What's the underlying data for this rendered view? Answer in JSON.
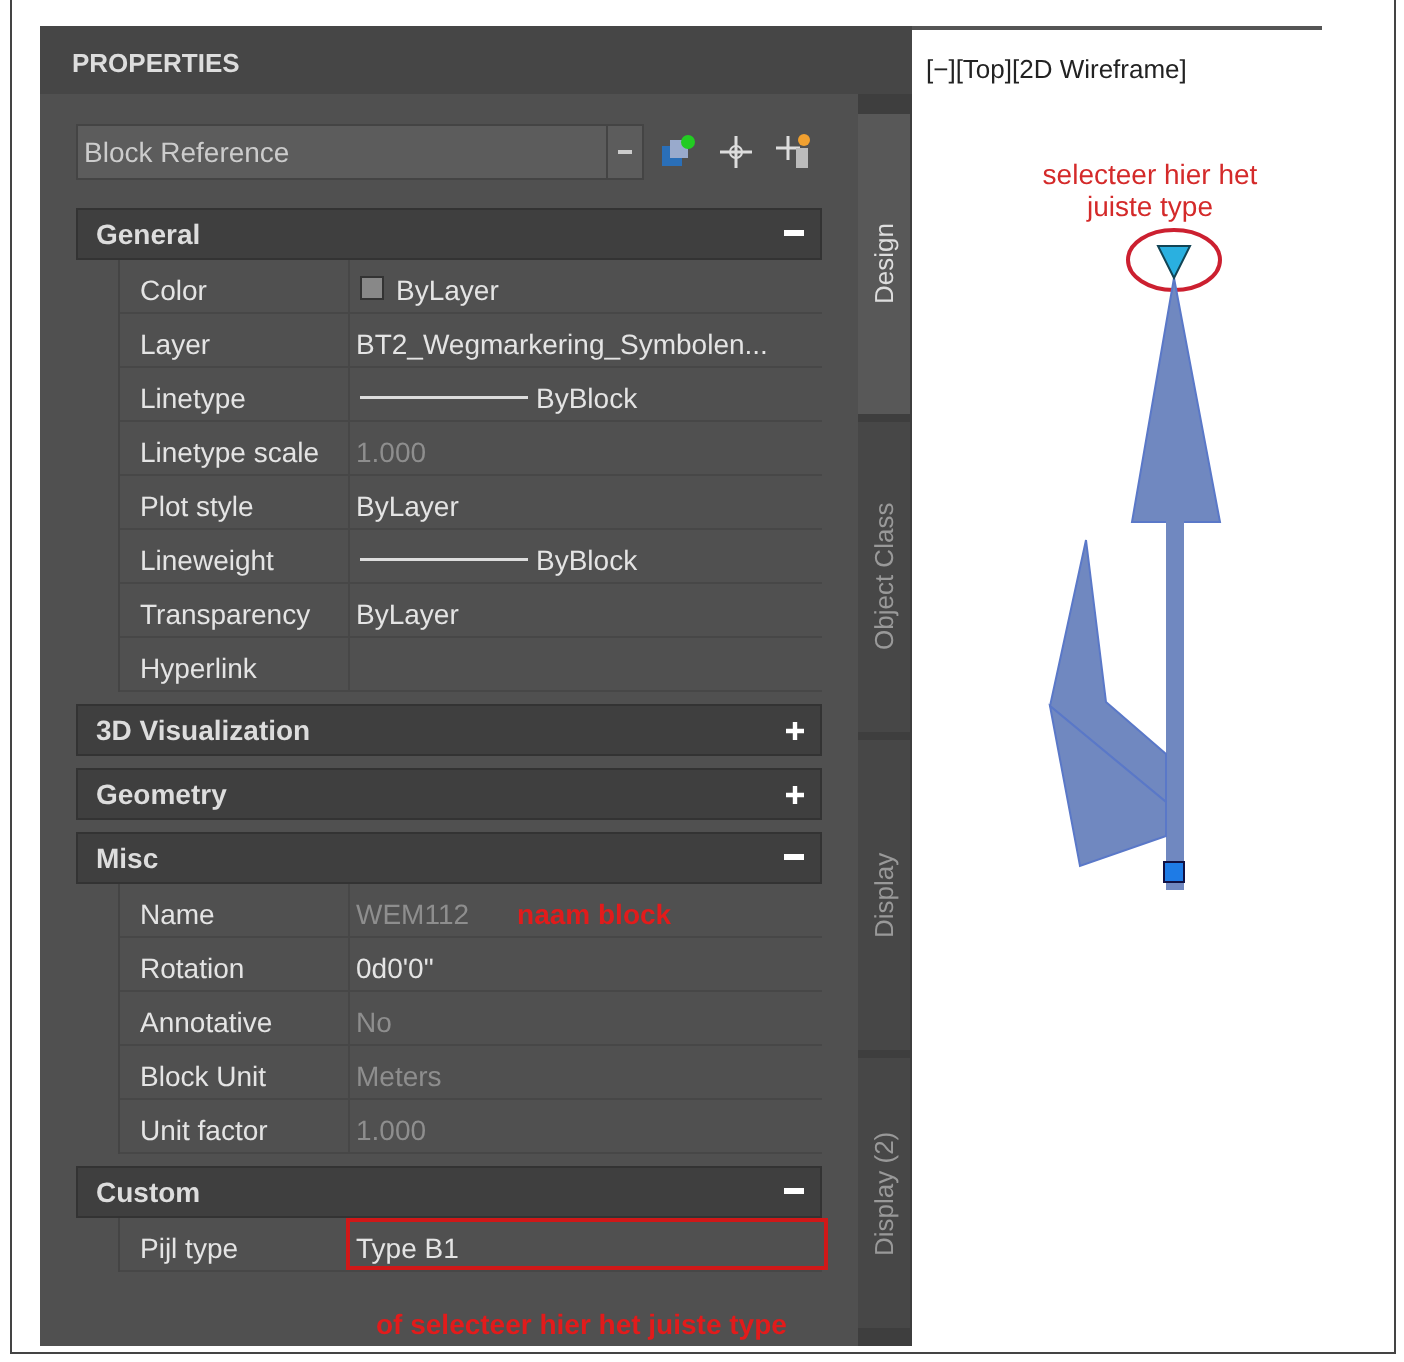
{
  "panel": {
    "title": "PROPERTIES",
    "selector": {
      "value": "Block Reference"
    },
    "sections": [
      {
        "title": "General",
        "expanded": true,
        "rows": [
          {
            "label": "Color",
            "value": "ByLayer",
            "kind": "color",
            "disabled": false
          },
          {
            "label": "Layer",
            "value": "BT2_Wegmarkering_Symbolen...",
            "kind": "text",
            "disabled": false
          },
          {
            "label": "Linetype",
            "value": "ByBlock",
            "kind": "line",
            "disabled": false
          },
          {
            "label": "Linetype scale",
            "value": "1.000",
            "kind": "text",
            "disabled": true
          },
          {
            "label": "Plot style",
            "value": "ByLayer",
            "kind": "text",
            "disabled": false
          },
          {
            "label": "Lineweight",
            "value": "ByBlock",
            "kind": "line",
            "disabled": false
          },
          {
            "label": "Transparency",
            "value": "ByLayer",
            "kind": "text",
            "disabled": false
          },
          {
            "label": "Hyperlink",
            "kind": "text",
            "disabled": false
          }
        ]
      },
      {
        "title": "3D Visualization",
        "expanded": false
      },
      {
        "title": "Geometry",
        "expanded": false
      },
      {
        "title": "Misc",
        "expanded": true,
        "rows": [
          {
            "label": "Name",
            "value": "WEM112",
            "kind": "text",
            "disabled": true,
            "annotation": "naam block"
          },
          {
            "label": "Rotation",
            "value": "0d0'0\"",
            "kind": "text",
            "disabled": false
          },
          {
            "label": "Annotative",
            "value": "No",
            "kind": "text",
            "disabled": true
          },
          {
            "label": "Block Unit",
            "value": "Meters",
            "kind": "text",
            "disabled": true
          },
          {
            "label": "Unit factor",
            "value": "1.000",
            "kind": "text",
            "disabled": true
          }
        ]
      },
      {
        "title": "Custom",
        "expanded": true,
        "rows": [
          {
            "label": "Pijl type",
            "value": "Type B1",
            "kind": "text",
            "disabled": false,
            "highlighted": true
          }
        ]
      }
    ],
    "annotation": "of selecteer hier het juiste type"
  },
  "tabs": [
    {
      "label": "Design",
      "selected": true
    },
    {
      "label": "Object Class",
      "selected": false
    },
    {
      "label": "Display",
      "selected": false
    },
    {
      "label": "Display (2)",
      "selected": false
    }
  ],
  "viewport": {
    "label": "[−][Top][2D Wireframe]",
    "note": "selecteer hier het juiste type"
  }
}
